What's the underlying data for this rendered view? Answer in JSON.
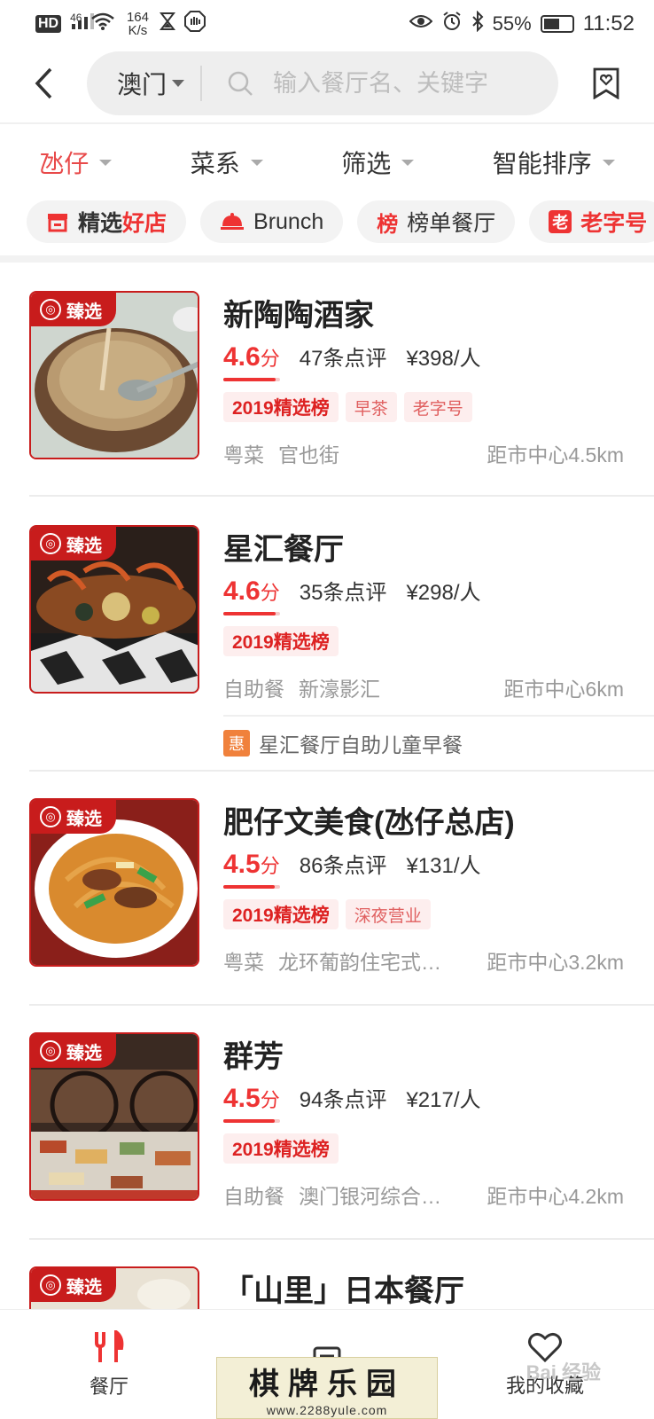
{
  "status_bar": {
    "network_hd": "HD",
    "network_gen": "46",
    "speed_value": "164",
    "speed_unit": "K/s",
    "battery_percent": "55%",
    "battery_level": 0.55,
    "time": "11:52"
  },
  "header": {
    "city": "澳门",
    "search_placeholder": "输入餐厅名、关键字"
  },
  "filters": [
    {
      "label": "氹仔",
      "active": true
    },
    {
      "label": "菜系",
      "active": false
    },
    {
      "label": "筛选",
      "active": false
    },
    {
      "label": "智能排序",
      "active": false
    }
  ],
  "chips": [
    {
      "prefix": "精选",
      "highlight": "好店",
      "icon": "shop-icon"
    },
    {
      "prefix": "Brunch",
      "highlight": "",
      "icon": "cloche-icon"
    },
    {
      "prefix": "榜单餐厅",
      "highlight": "",
      "icon": "ranking-icon",
      "icon_text": "榜"
    },
    {
      "prefix": "老字号",
      "highlight": "",
      "icon": "old-brand-icon",
      "icon_text": "老"
    }
  ],
  "badge_label": "臻选",
  "score_unit": "分",
  "restaurants": [
    {
      "name": "新陶陶酒家",
      "score": "4.6",
      "rating": 4.6,
      "reviews": "47条点评",
      "price": "¥398/人",
      "tags": [
        {
          "text": "2019精选榜",
          "kind": "rank"
        },
        {
          "text": "早茶",
          "kind": "feat"
        },
        {
          "text": "老字号",
          "kind": "feat"
        }
      ],
      "cuisine": "粤菜",
      "area": "官也街",
      "distance": "距市中心4.5km"
    },
    {
      "name": "星汇餐厅",
      "score": "4.6",
      "rating": 4.6,
      "reviews": "35条点评",
      "price": "¥298/人",
      "tags": [
        {
          "text": "2019精选榜",
          "kind": "rank"
        }
      ],
      "cuisine": "自助餐",
      "area": "新濠影汇",
      "distance": "距市中心6km",
      "promo_icon": "惠",
      "promo": "星汇餐厅自助儿童早餐"
    },
    {
      "name": "肥仔文美食(氹仔总店)",
      "score": "4.5",
      "rating": 4.5,
      "reviews": "86条点评",
      "price": "¥131/人",
      "tags": [
        {
          "text": "2019精选榜",
          "kind": "rank"
        },
        {
          "text": "深夜营业",
          "kind": "feat"
        }
      ],
      "cuisine": "粤菜",
      "area": "龙环葡韵住宅式…",
      "distance": "距市中心3.2km"
    },
    {
      "name": "群芳",
      "score": "4.5",
      "rating": 4.5,
      "reviews": "94条点评",
      "price": "¥217/人",
      "tags": [
        {
          "text": "2019精选榜",
          "kind": "rank"
        }
      ],
      "cuisine": "自助餐",
      "area": "澳门银河综合…",
      "distance": "距市中心4.2km"
    },
    {
      "name": "「山里」日本餐厅"
    }
  ],
  "bottom_nav": [
    {
      "label": "餐厅",
      "icon": "cutlery-icon",
      "active": true
    },
    {
      "label": "",
      "icon": "list-icon",
      "active": false
    },
    {
      "label": "我的收藏",
      "icon": "heart-icon",
      "active": false
    }
  ],
  "watermark": {
    "title": "棋牌乐园",
    "url": "www.2288yule.com",
    "baidu": "Bai 经验"
  },
  "colors": {
    "accent": "#e84a4a",
    "badge": "#c81c1c",
    "promo": "#f0813c"
  }
}
